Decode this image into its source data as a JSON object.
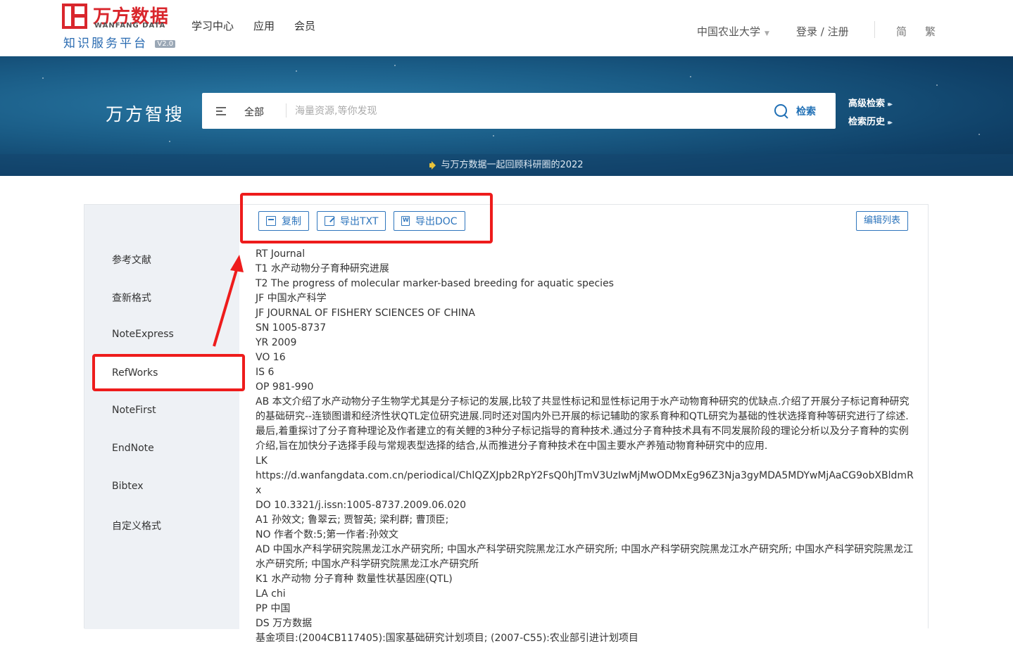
{
  "header": {
    "logo_cn": "万方数据",
    "logo_en": "WANFANG DATA",
    "logo_sub": "知识服务平台",
    "logo_version": "V2.0",
    "nav": [
      "学习中心",
      "应用",
      "会员"
    ],
    "institution": "中国农业大学",
    "login": "登录 / 注册",
    "lang_simplified": "简",
    "lang_traditional": "繁"
  },
  "banner": {
    "brand": "万方智搜",
    "scope": "全部",
    "search_placeholder": "海量资源,等你发现",
    "search_button": "检索",
    "advanced_search": "高级检索",
    "search_history": "检索历史",
    "notice": "与万方数据一起回顾科研圈的2022"
  },
  "toolbar": {
    "copy": "复制",
    "export_txt": "导出TXT",
    "export_doc": "导出DOC",
    "edit_list": "编辑列表"
  },
  "sidebar": {
    "items": [
      "参考文献",
      "查新格式",
      "NoteExpress",
      "RefWorks",
      "NoteFirst",
      "EndNote",
      "Bibtex",
      "自定义格式"
    ],
    "active": "RefWorks"
  },
  "citation": {
    "lines": [
      "RT Journal",
      "T1 水产动物分子育种研究进展",
      "T2 The progress of molecular marker-based breeding for aquatic species",
      "JF 中国水产科学",
      "JF JOURNAL OF FISHERY SCIENCES OF CHINA",
      "SN 1005-8737",
      "YR 2009",
      "VO 16",
      "IS 6",
      "OP 981-990"
    ],
    "abstract": "AB 本文介绍了水产动物分子生物学尤其是分子标记的发展,比较了共显性标记和显性标记用于水产动物育种研究的优缺点.介绍了开展分子标记育种研究的基础研究--连锁图谱和经济性状QTL定位研究进展.同时还对国内外已开展的标记辅助的家系育种和QTL研究为基础的性状选择育种等研究进行了综述.最后,着重探讨了分子育种理论及作者建立的有关鲤的3种分子标记指导的育种技术.通过分子育种技术具有不同发展阶段的理论分析以及分子育种的实例介绍,旨在加快分子选择手段与常规表型选择的结合,从而推进分子育种技术在中国主要水产养殖动物育种研究中的应用.",
    "lk": "LK",
    "url": "https://d.wanfangdata.com.cn/periodical/ChlQZXJpb2RpY2FsQ0hJTmV3UzIwMjMwODMxEg96Z3Nja3gyMDA5MDYwMjAaCG9obXBldmRx",
    "doi": "DO 10.3321/j.issn:1005-8737.2009.06.020",
    "authors": "A1 孙效文; 鲁翠云; 贾智英; 梁利群; 曹顶臣;",
    "notes": "NO 作者个数:5;第一作者:孙效文",
    "affiliations": "AD 中国水产科学研究院黑龙江水产研究所; 中国水产科学研究院黑龙江水产研究所; 中国水产科学研究院黑龙江水产研究所; 中国水产科学研究院黑龙江水产研究所; 中国水产科学研究院黑龙江水产研究所",
    "keywords": "K1 水产动物 分子育种 数量性状基因座(QTL)",
    "language": "LA chi",
    "place": "PP 中国",
    "database": "DS 万方数据",
    "funding": "基金项目:(2004CB117405):国家基础研究计划项目; (2007-C55):农业部引进计划项目"
  },
  "colors": {
    "brand_red": "#d9262c",
    "link_blue": "#2f76bd",
    "annotation_red": "#ee1c1c"
  }
}
